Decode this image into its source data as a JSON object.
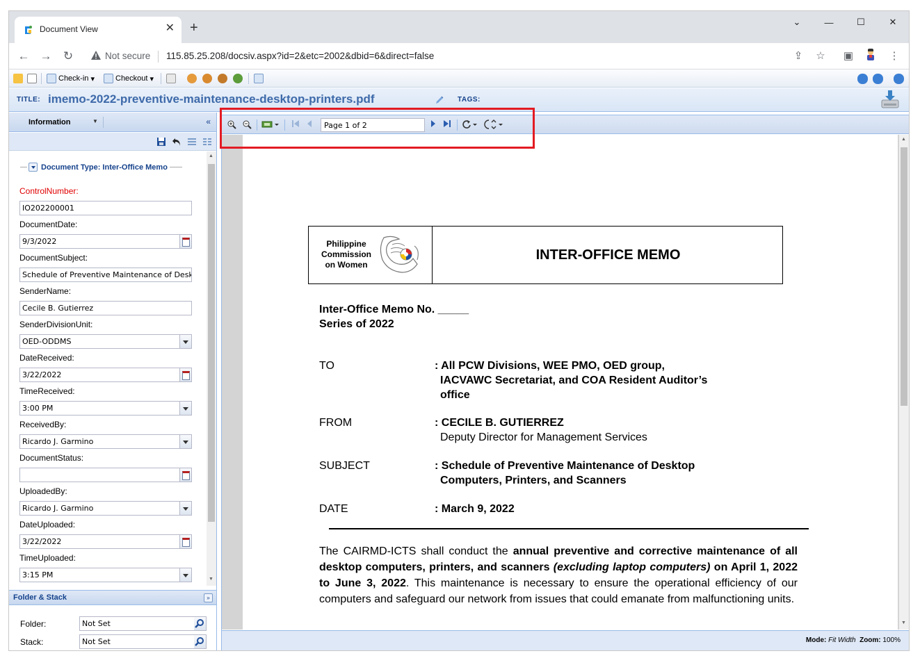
{
  "browser": {
    "tab_title": "Document View",
    "security_label": "Not secure",
    "url": "115.85.25.208/docsiv.aspx?id=2&etc=2002&dbid=6&direct=false"
  },
  "app_toolbar": {
    "checkin_label": "Check-in",
    "checkout_label": "Checkout"
  },
  "title_row": {
    "title_label": "TITLE:",
    "title_value": "imemo-2022-preventive-maintenance-desktop-printers.pdf",
    "tags_label": "TAGS:"
  },
  "left_panel": {
    "tab_label": "Information",
    "document_type": "Document Type: Inter-Office Memo",
    "fields": [
      {
        "label": "ControlNumber:",
        "value": "IO202200001"
      },
      {
        "label": "DocumentDate:",
        "value": "9/3/2022"
      },
      {
        "label": "DocumentSubject:",
        "value": "Schedule of Preventive Maintenance of Deskt"
      },
      {
        "label": "SenderName:",
        "value": "Cecile B. Gutierrez"
      },
      {
        "label": "SenderDivisionUnit:",
        "value": "OED-ODDMS"
      },
      {
        "label": "DateReceived:",
        "value": "3/22/2022"
      },
      {
        "label": "TimeReceived:",
        "value": "3:00 PM"
      },
      {
        "label": "ReceivedBy:",
        "value": "Ricardo J. Garmino"
      },
      {
        "label": "DocumentStatus:",
        "value": ""
      },
      {
        "label": "UploadedBy:",
        "value": "Ricardo J. Garmino"
      },
      {
        "label": "DateUploaded:",
        "value": "3/22/2022"
      },
      {
        "label": "TimeUploaded:",
        "value": "3:15 PM"
      }
    ],
    "folder_stack": {
      "title": "Folder & Stack",
      "folder_label": "Folder:",
      "folder_value": "Not Set",
      "stack_label": "Stack:",
      "stack_value": "Not Set"
    }
  },
  "viewer": {
    "page_indicator": "Page 1 of 2",
    "mode_label": "Mode:",
    "mode_value": "Fit Width",
    "zoom_label": "Zoom:",
    "zoom_value": "100%"
  },
  "memo": {
    "org_line1": "Philippine",
    "org_line2": "Commission",
    "org_line3": "on Women",
    "header_title": "INTER-OFFICE MEMO",
    "memo_no": "Inter-Office Memo No. _____",
    "series": "Series of 2022",
    "to_label": "TO",
    "to_line1": ": All PCW Divisions, WEE PMO, OED group,",
    "to_line2": "IACVAWC Secretariat, and COA Resident Auditor’s",
    "to_line3": "office",
    "from_label": "FROM",
    "from_line1": ": CECILE B. GUTIERREZ",
    "from_line2": "Deputy Director for Management Services",
    "subject_label": "SUBJECT",
    "subject_line1": ": Schedule of Preventive Maintenance of Desktop",
    "subject_line2": "Computers,  Printers, and Scanners",
    "date_label": "DATE",
    "date_value": ": March 9, 2022",
    "para_p1": "The CAIRMD-ICTS shall conduct the ",
    "para_b1": "annual preventive and corrective maintenance of all desktop computers, printers, and scanners ",
    "para_i1": "(excluding laptop computers)",
    "para_b2": " on April 1, 2022 to June 3, 2022",
    "para_p2": ". This maintenance is necessary to ensure the operational efficiency of our computers and safeguard our network from issues that could emanate from malfunctioning units."
  },
  "colors": {
    "accent_blue": "#15428b",
    "panel_border": "#99bbe8",
    "highlight_red": "#e31b23",
    "required_label": "#e00000"
  }
}
